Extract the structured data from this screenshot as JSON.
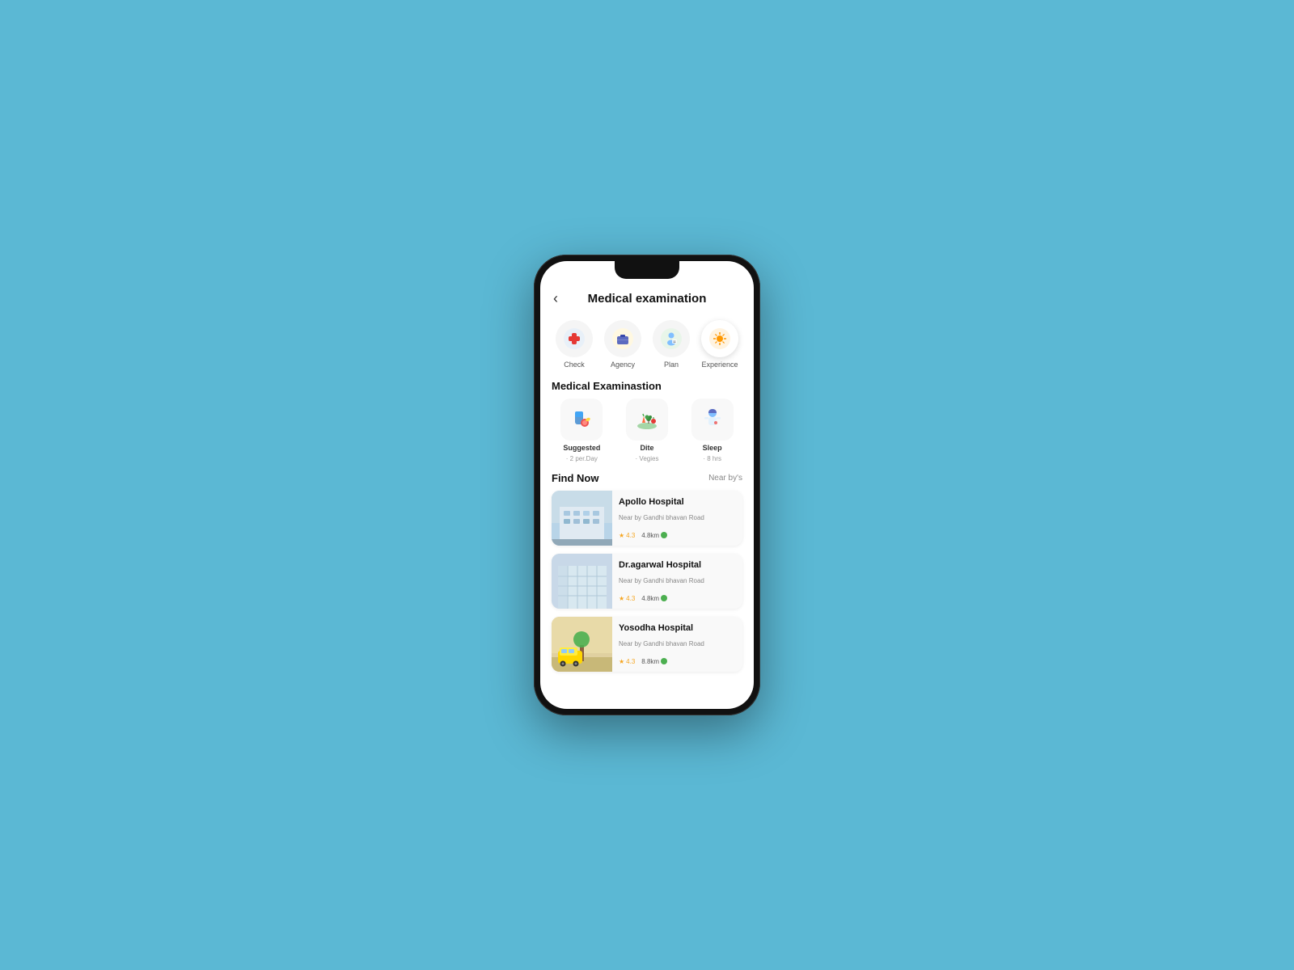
{
  "header": {
    "back_label": "‹",
    "title": "Medical examination"
  },
  "categories": [
    {
      "id": "check",
      "emoji": "🩺",
      "label": "Check",
      "active": false
    },
    {
      "id": "agency",
      "emoji": "💼",
      "label": "Agency",
      "active": false
    },
    {
      "id": "plan",
      "emoji": "👤",
      "label": "Plan",
      "active": false
    },
    {
      "id": "experience",
      "emoji": "✨",
      "label": "Experience",
      "active": true
    }
  ],
  "medical_section_title": "Medical Examinastion",
  "medical_items": [
    {
      "id": "suggested",
      "emoji": "💊",
      "name": "Suggested",
      "sub": "· 2 per.Day"
    },
    {
      "id": "dite",
      "emoji": "🥗",
      "name": "Dite",
      "sub": "· Vegies"
    },
    {
      "id": "sleep",
      "emoji": "🧑‍⚕️",
      "name": "Sleep",
      "sub": "· 8 hrs"
    }
  ],
  "find_now": {
    "title": "Find Now",
    "link": "Near by's"
  },
  "hospitals": [
    {
      "id": "apollo",
      "name": "Apollo Hospital",
      "address": "Near by Gandhi bhavan Road",
      "rating": "4.3",
      "distance": "4.8km",
      "img_type": "apollo"
    },
    {
      "id": "agarwal",
      "name": "Dr.agarwal Hospital",
      "address": "Near by Gandhi bhavan Road",
      "rating": "4.3",
      "distance": "4.8km",
      "img_type": "agarwal"
    },
    {
      "id": "yosodha",
      "name": "Yosodha Hospital",
      "address": "Near by Gandhi bhavan Road",
      "rating": "4.3",
      "distance": "8.8km",
      "img_type": "yosodha"
    }
  ],
  "icons": {
    "star": "★",
    "location_pin": "📍"
  }
}
